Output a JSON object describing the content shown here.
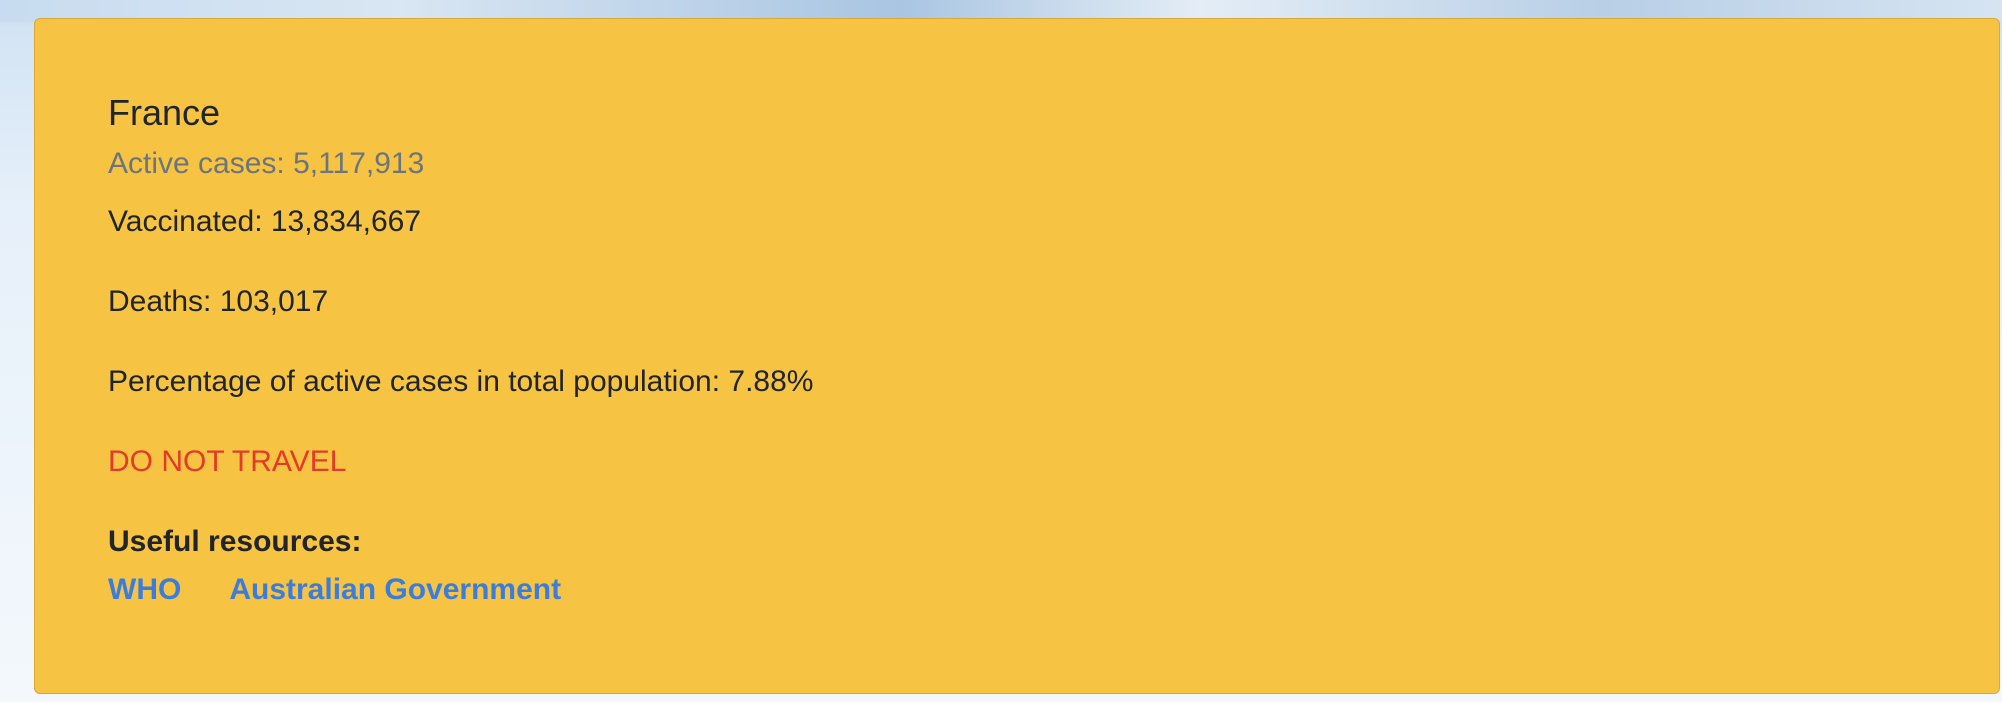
{
  "card": {
    "country": "France",
    "active_cases": "Active cases: 5,117,913",
    "vaccinated": "Vaccinated: 13,834,667",
    "deaths": "Deaths: 103,017",
    "percentage": "Percentage of active cases in total population: 7.88%",
    "advisory": "DO NOT TRAVEL",
    "resources_title": "Useful resources:",
    "links": [
      {
        "label": "WHO"
      },
      {
        "label": "Australian Government"
      }
    ]
  },
  "colors": {
    "card_background": "#f6c343",
    "advisory": "#e33b27",
    "link": "#3b7ddd",
    "muted": "#6c757d"
  }
}
